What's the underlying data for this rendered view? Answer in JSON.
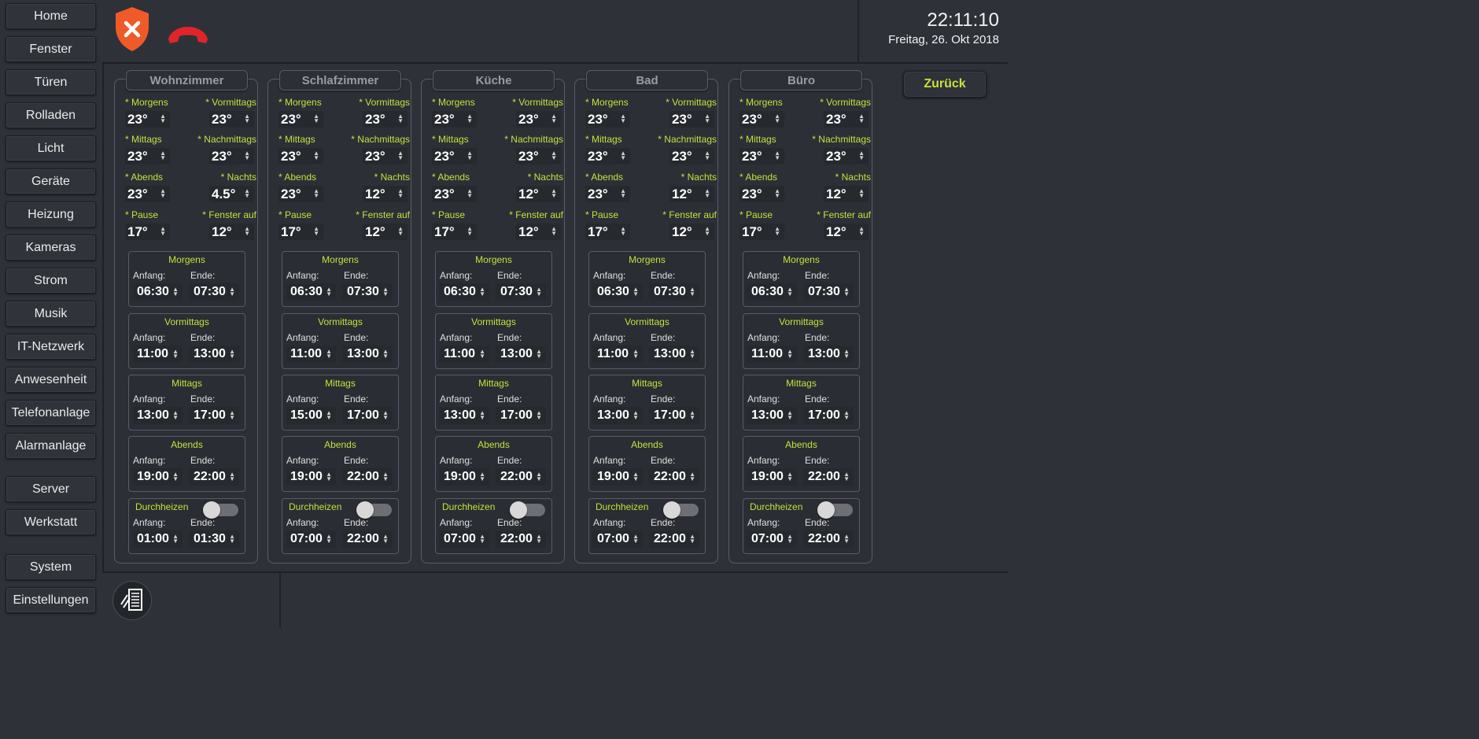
{
  "nav": {
    "items": [
      "Home",
      "Fenster",
      "Türen",
      "Rolladen",
      "Licht",
      "Geräte",
      "Heizung",
      "Kameras",
      "Strom",
      "Musik",
      "IT-Netzwerk",
      "Anwesenheit",
      "Telefonanlage",
      "Alarmanlage",
      "Server",
      "Werkstatt",
      "System",
      "Einstellungen"
    ]
  },
  "header": {
    "time": "22:11:10",
    "date": "Freitag, 26. Okt 2018",
    "shield_icon": "alarm-disarmed-shield-icon",
    "phone_icon": "phone-hangup-icon"
  },
  "back_label": "Zurück",
  "labels": {
    "anfang": "Anfang:",
    "ende": "Ende:",
    "temp": [
      "* Morgens",
      "* Vormittags",
      "* Mittags",
      "* Nachmittags",
      "* Abends",
      "* Nachts",
      "* Pause",
      "* Fenster auf"
    ],
    "sched": [
      "Morgens",
      "Vormittags",
      "Mittags",
      "Abends",
      "Durchheizen"
    ]
  },
  "rooms": [
    {
      "name": "Wohnzimmer",
      "temps": [
        "23°",
        "23°",
        "23°",
        "23°",
        "23°",
        "4.5°",
        "17°",
        "12°"
      ],
      "schedule": [
        [
          "06:30",
          "07:30"
        ],
        [
          "11:00",
          "13:00"
        ],
        [
          "13:00",
          "17:00"
        ],
        [
          "19:00",
          "22:00"
        ],
        [
          "01:00",
          "01:30"
        ]
      ],
      "durchheizen_on": false
    },
    {
      "name": "Schlafzimmer",
      "temps": [
        "23°",
        "23°",
        "23°",
        "23°",
        "23°",
        "12°",
        "17°",
        "12°"
      ],
      "schedule": [
        [
          "06:30",
          "07:30"
        ],
        [
          "11:00",
          "13:00"
        ],
        [
          "15:00",
          "17:00"
        ],
        [
          "19:00",
          "22:00"
        ],
        [
          "07:00",
          "22:00"
        ]
      ],
      "durchheizen_on": false
    },
    {
      "name": "Küche",
      "temps": [
        "23°",
        "23°",
        "23°",
        "23°",
        "23°",
        "12°",
        "17°",
        "12°"
      ],
      "schedule": [
        [
          "06:30",
          "07:30"
        ],
        [
          "11:00",
          "13:00"
        ],
        [
          "13:00",
          "17:00"
        ],
        [
          "19:00",
          "22:00"
        ],
        [
          "07:00",
          "22:00"
        ]
      ],
      "durchheizen_on": false
    },
    {
      "name": "Bad",
      "temps": [
        "23°",
        "23°",
        "23°",
        "23°",
        "23°",
        "12°",
        "17°",
        "12°"
      ],
      "schedule": [
        [
          "06:30",
          "07:30"
        ],
        [
          "11:00",
          "13:00"
        ],
        [
          "13:00",
          "17:00"
        ],
        [
          "19:00",
          "22:00"
        ],
        [
          "07:00",
          "22:00"
        ]
      ],
      "durchheizen_on": false
    },
    {
      "name": "Büro",
      "temps": [
        "23°",
        "23°",
        "23°",
        "23°",
        "23°",
        "12°",
        "17°",
        "12°"
      ],
      "schedule": [
        [
          "06:30",
          "07:30"
        ],
        [
          "11:00",
          "13:00"
        ],
        [
          "13:00",
          "17:00"
        ],
        [
          "19:00",
          "22:00"
        ],
        [
          "07:00",
          "22:00"
        ]
      ],
      "durchheizen_on": false
    }
  ],
  "colors": {
    "accent": "#c7e03a",
    "background": "#2e3138",
    "alarm": "#f05a28"
  }
}
